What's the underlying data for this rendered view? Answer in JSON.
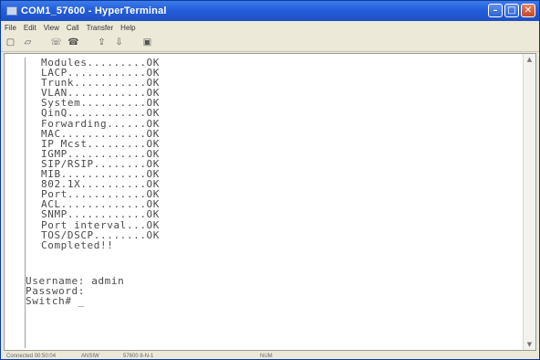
{
  "window": {
    "title": "COM1_57600 - HyperTerminal"
  },
  "menu": {
    "items": [
      "File",
      "Edit",
      "View",
      "Call",
      "Transfer",
      "Help"
    ]
  },
  "toolbar": {
    "icons": [
      "new-icon",
      "open-icon",
      "call-icon",
      "disconnect-icon",
      "send-icon",
      "receive-icon",
      "properties-icon"
    ]
  },
  "terminal": {
    "lines": [
      "Modules.........OK",
      "LACP............OK",
      "Trunk...........OK",
      "VLAN............OK",
      "System..........OK",
      "QinQ............OK",
      "Forwarding......OK",
      "MAC.............OK",
      "IP Mcst.........OK",
      "IGMP............OK",
      "SIP/RSIP........OK",
      "MIB.............OK",
      "802.1X..........OK",
      "Port............OK",
      "ACL.............OK",
      "SNMP............OK",
      "Port interval...OK",
      "TOS/DSCP........OK",
      "Completed!!"
    ],
    "login": {
      "username_line": "Username: admin",
      "password_line": "Password:",
      "prompt_line": "Switch# _"
    }
  },
  "status": {
    "connected": "Connected 00:50:04",
    "emulation": "ANSIW",
    "settings": "57600 8-N-1",
    "num": "NUM"
  }
}
